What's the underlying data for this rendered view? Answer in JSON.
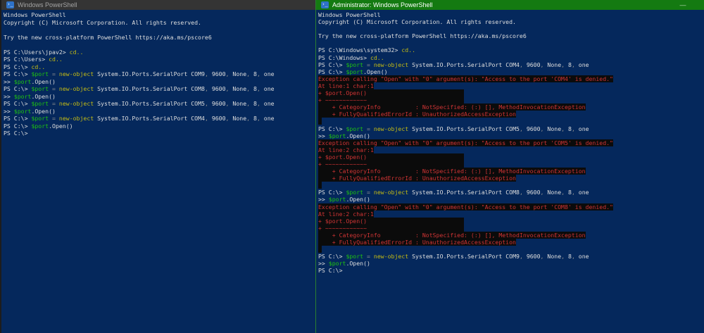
{
  "colors": {
    "console_bg": "#05285c",
    "error_bg": "#0b0b0b",
    "error_red": "#d03434",
    "text_white": "#dedede",
    "command_yellow": "#c3ba14",
    "variable_green": "#1fc40f",
    "operator_gray": "#8f8f8f",
    "admin_title_green": "#147a11",
    "admin_border_green": "#2a7f2e",
    "inactive_title_gray": "#343434",
    "inactive_title_text": "#a3a3a3",
    "ps_icon_blue": "#2e72c8"
  },
  "icons": {
    "powershell_glyph": "›_"
  },
  "left_window": {
    "title": "Windows PowerShell",
    "lines": [
      [
        {
          "t": "Windows PowerShell",
          "c": "w"
        }
      ],
      [
        {
          "t": "Copyright (C) Microsoft Corporation. All rights reserved.",
          "c": "w"
        }
      ],
      [],
      [
        {
          "t": "Try the new cross-platform PowerShell https://aka.ms/pscore6",
          "c": "w"
        }
      ],
      [],
      [
        {
          "t": "PS C:\\Users\\jpav2> ",
          "c": "w"
        },
        {
          "t": "cd..",
          "c": "y"
        }
      ],
      [
        {
          "t": "PS C:\\Users> ",
          "c": "w"
        },
        {
          "t": "cd..",
          "c": "y"
        }
      ],
      [
        {
          "t": "PS C:\\> ",
          "c": "w"
        },
        {
          "t": "cd..",
          "c": "y"
        }
      ],
      [
        {
          "t": "PS C:\\> ",
          "c": "w"
        },
        {
          "t": "$port",
          "c": "g"
        },
        {
          "t": " ",
          "c": "w"
        },
        {
          "t": "=",
          "c": "d"
        },
        {
          "t": " ",
          "c": "w"
        },
        {
          "t": "new-object",
          "c": "y"
        },
        {
          "t": " System.IO.Ports.SerialPort COM9",
          "c": "w"
        },
        {
          "t": ",",
          "c": "d"
        },
        {
          "t": " 9600",
          "c": "w"
        },
        {
          "t": ",",
          "c": "d"
        },
        {
          "t": " None",
          "c": "w"
        },
        {
          "t": ",",
          "c": "d"
        },
        {
          "t": " 8",
          "c": "w"
        },
        {
          "t": ",",
          "c": "d"
        },
        {
          "t": " one",
          "c": "w"
        }
      ],
      [
        {
          "t": ">> ",
          "c": "w"
        },
        {
          "t": "$port",
          "c": "g"
        },
        {
          "t": ".Open()",
          "c": "w"
        }
      ],
      [
        {
          "t": "PS C:\\> ",
          "c": "w"
        },
        {
          "t": "$port",
          "c": "g"
        },
        {
          "t": " ",
          "c": "w"
        },
        {
          "t": "=",
          "c": "d"
        },
        {
          "t": " ",
          "c": "w"
        },
        {
          "t": "new-object",
          "c": "y"
        },
        {
          "t": " System.IO.Ports.SerialPort COM8",
          "c": "w"
        },
        {
          "t": ",",
          "c": "d"
        },
        {
          "t": " 9600",
          "c": "w"
        },
        {
          "t": ",",
          "c": "d"
        },
        {
          "t": " None",
          "c": "w"
        },
        {
          "t": ",",
          "c": "d"
        },
        {
          "t": " 8",
          "c": "w"
        },
        {
          "t": ",",
          "c": "d"
        },
        {
          "t": " one",
          "c": "w"
        }
      ],
      [
        {
          "t": ">> ",
          "c": "w"
        },
        {
          "t": "$port",
          "c": "g"
        },
        {
          "t": ".Open()",
          "c": "w"
        }
      ],
      [
        {
          "t": "PS C:\\> ",
          "c": "w"
        },
        {
          "t": "$port",
          "c": "g"
        },
        {
          "t": " ",
          "c": "w"
        },
        {
          "t": "=",
          "c": "d"
        },
        {
          "t": " ",
          "c": "w"
        },
        {
          "t": "new-object",
          "c": "y"
        },
        {
          "t": " System.IO.Ports.SerialPort COM5",
          "c": "w"
        },
        {
          "t": ",",
          "c": "d"
        },
        {
          "t": " 9600",
          "c": "w"
        },
        {
          "t": ",",
          "c": "d"
        },
        {
          "t": " None",
          "c": "w"
        },
        {
          "t": ",",
          "c": "d"
        },
        {
          "t": " 8",
          "c": "w"
        },
        {
          "t": ",",
          "c": "d"
        },
        {
          "t": " one",
          "c": "w"
        }
      ],
      [
        {
          "t": ">> ",
          "c": "w"
        },
        {
          "t": "$port",
          "c": "g"
        },
        {
          "t": ".Open()",
          "c": "w"
        }
      ],
      [
        {
          "t": "PS C:\\> ",
          "c": "w"
        },
        {
          "t": "$port",
          "c": "g"
        },
        {
          "t": " ",
          "c": "w"
        },
        {
          "t": "=",
          "c": "d"
        },
        {
          "t": " ",
          "c": "w"
        },
        {
          "t": "new-object",
          "c": "y"
        },
        {
          "t": " System.IO.Ports.SerialPort COM4",
          "c": "w"
        },
        {
          "t": ",",
          "c": "d"
        },
        {
          "t": " 9600",
          "c": "w"
        },
        {
          "t": ",",
          "c": "d"
        },
        {
          "t": " None",
          "c": "w"
        },
        {
          "t": ",",
          "c": "d"
        },
        {
          "t": " 8",
          "c": "w"
        },
        {
          "t": ",",
          "c": "d"
        },
        {
          "t": " one",
          "c": "w"
        }
      ],
      [
        {
          "t": "PS C:\\> ",
          "c": "w"
        },
        {
          "t": "$port",
          "c": "g"
        },
        {
          "t": ".Open()",
          "c": "w"
        }
      ],
      [
        {
          "t": "PS C:\\>",
          "c": "w"
        }
      ]
    ]
  },
  "right_window": {
    "title": "Administrator: Windows PowerShell",
    "minimize_label": "—",
    "lines": [
      [
        {
          "t": "Windows PowerShell",
          "c": "w"
        }
      ],
      [
        {
          "t": "Copyright (C) Microsoft Corporation. All rights reserved.",
          "c": "w"
        }
      ],
      [],
      [
        {
          "t": "Try the new cross-platform PowerShell https://aka.ms/pscore6",
          "c": "w"
        }
      ],
      [],
      [
        {
          "t": "PS C:\\Windows\\system32> ",
          "c": "w"
        },
        {
          "t": "cd..",
          "c": "y"
        }
      ],
      [
        {
          "t": "PS C:\\Windows> ",
          "c": "w"
        },
        {
          "t": "cd..",
          "c": "y"
        }
      ],
      [
        {
          "t": "PS C:\\> ",
          "c": "w"
        },
        {
          "t": "$port",
          "c": "g"
        },
        {
          "t": " ",
          "c": "w"
        },
        {
          "t": "=",
          "c": "d"
        },
        {
          "t": " ",
          "c": "w"
        },
        {
          "t": "new-object",
          "c": "y"
        },
        {
          "t": " System.IO.Ports.SerialPort COM4",
          "c": "w"
        },
        {
          "t": ",",
          "c": "d"
        },
        {
          "t": " 9600",
          "c": "w"
        },
        {
          "t": ",",
          "c": "d"
        },
        {
          "t": " None",
          "c": "w"
        },
        {
          "t": ",",
          "c": "d"
        },
        {
          "t": " 8",
          "c": "w"
        },
        {
          "t": ",",
          "c": "d"
        },
        {
          "t": " one",
          "c": "w"
        }
      ],
      [
        {
          "t": "PS C:\\> ",
          "c": "w"
        },
        {
          "t": "$port",
          "c": "g"
        },
        {
          "t": ".Open()",
          "c": "w"
        }
      ],
      [
        {
          "t": "Exception calling \"Open\" with \"0\" argument(s): \"Access to the port 'COM4' is denied.\"",
          "c": "r"
        }
      ],
      [
        {
          "t": "At line:1 char:1",
          "c": "r"
        }
      ],
      [
        {
          "t": "+ $port.Open()                            ",
          "c": "r"
        }
      ],
      [
        {
          "t": "+ ~~~~~~~~~~~~                            ",
          "c": "r"
        }
      ],
      [
        {
          "t": "    + CategoryInfo          : NotSpecified: (:) [], MethodInvocationException",
          "c": "r"
        }
      ],
      [
        {
          "t": "    + FullyQualifiedErrorId : UnauthorizedAccessException",
          "c": "r"
        }
      ],
      [
        {
          "t": " ",
          "c": "r"
        }
      ],
      [
        {
          "t": "PS C:\\> ",
          "c": "w"
        },
        {
          "t": "$port",
          "c": "g"
        },
        {
          "t": " ",
          "c": "w"
        },
        {
          "t": "=",
          "c": "d"
        },
        {
          "t": " ",
          "c": "w"
        },
        {
          "t": "new-object",
          "c": "y"
        },
        {
          "t": " System.IO.Ports.SerialPort COM5",
          "c": "w"
        },
        {
          "t": ",",
          "c": "d"
        },
        {
          "t": " 9600",
          "c": "w"
        },
        {
          "t": ",",
          "c": "d"
        },
        {
          "t": " None",
          "c": "w"
        },
        {
          "t": ",",
          "c": "d"
        },
        {
          "t": " 8",
          "c": "w"
        },
        {
          "t": ",",
          "c": "d"
        },
        {
          "t": " one",
          "c": "w"
        }
      ],
      [
        {
          "t": ">> ",
          "c": "w"
        },
        {
          "t": "$port",
          "c": "g"
        },
        {
          "t": ".Open()",
          "c": "w"
        }
      ],
      [
        {
          "t": "Exception calling \"Open\" with \"0\" argument(s): \"Access to the port 'COM5' is denied.\"",
          "c": "r"
        }
      ],
      [
        {
          "t": "At line:2 char:1",
          "c": "r"
        }
      ],
      [
        {
          "t": "+ $port.Open()                            ",
          "c": "r"
        }
      ],
      [
        {
          "t": "+ ~~~~~~~~~~~~                            ",
          "c": "r"
        }
      ],
      [
        {
          "t": "    + CategoryInfo          : NotSpecified: (:) [], MethodInvocationException",
          "c": "r"
        }
      ],
      [
        {
          "t": "    + FullyQualifiedErrorId : UnauthorizedAccessException",
          "c": "r"
        }
      ],
      [
        {
          "t": " ",
          "c": "r"
        }
      ],
      [
        {
          "t": "PS C:\\> ",
          "c": "w"
        },
        {
          "t": "$port",
          "c": "g"
        },
        {
          "t": " ",
          "c": "w"
        },
        {
          "t": "=",
          "c": "d"
        },
        {
          "t": " ",
          "c": "w"
        },
        {
          "t": "new-object",
          "c": "y"
        },
        {
          "t": " System.IO.Ports.SerialPort COM8",
          "c": "w"
        },
        {
          "t": ",",
          "c": "d"
        },
        {
          "t": " 9600",
          "c": "w"
        },
        {
          "t": ",",
          "c": "d"
        },
        {
          "t": " None",
          "c": "w"
        },
        {
          "t": ",",
          "c": "d"
        },
        {
          "t": " 8",
          "c": "w"
        },
        {
          "t": ",",
          "c": "d"
        },
        {
          "t": " one",
          "c": "w"
        }
      ],
      [
        {
          "t": ">> ",
          "c": "w"
        },
        {
          "t": "$port",
          "c": "g"
        },
        {
          "t": ".Open()",
          "c": "w"
        }
      ],
      [
        {
          "t": "Exception calling \"Open\" with \"0\" argument(s): \"Access to the port 'COM8' is denied.\"",
          "c": "r"
        }
      ],
      [
        {
          "t": "At line:2 char:1",
          "c": "r"
        }
      ],
      [
        {
          "t": "+ $port.Open()                            ",
          "c": "r"
        }
      ],
      [
        {
          "t": "+ ~~~~~~~~~~~~                            ",
          "c": "r"
        }
      ],
      [
        {
          "t": "    + CategoryInfo          : NotSpecified: (:) [], MethodInvocationException",
          "c": "r"
        }
      ],
      [
        {
          "t": "    + FullyQualifiedErrorId : UnauthorizedAccessException",
          "c": "r"
        }
      ],
      [
        {
          "t": " ",
          "c": "r"
        }
      ],
      [
        {
          "t": "PS C:\\> ",
          "c": "w"
        },
        {
          "t": "$port",
          "c": "g"
        },
        {
          "t": " ",
          "c": "w"
        },
        {
          "t": "=",
          "c": "d"
        },
        {
          "t": " ",
          "c": "w"
        },
        {
          "t": "new-object",
          "c": "y"
        },
        {
          "t": " System.IO.Ports.SerialPort COM9",
          "c": "w"
        },
        {
          "t": ",",
          "c": "d"
        },
        {
          "t": " 9600",
          "c": "w"
        },
        {
          "t": ",",
          "c": "d"
        },
        {
          "t": " None",
          "c": "w"
        },
        {
          "t": ",",
          "c": "d"
        },
        {
          "t": " 8",
          "c": "w"
        },
        {
          "t": ",",
          "c": "d"
        },
        {
          "t": " one",
          "c": "w"
        }
      ],
      [
        {
          "t": ">> ",
          "c": "w"
        },
        {
          "t": "$port",
          "c": "g"
        },
        {
          "t": ".Open()",
          "c": "w"
        }
      ],
      [
        {
          "t": "PS C:\\>",
          "c": "w"
        }
      ]
    ]
  }
}
